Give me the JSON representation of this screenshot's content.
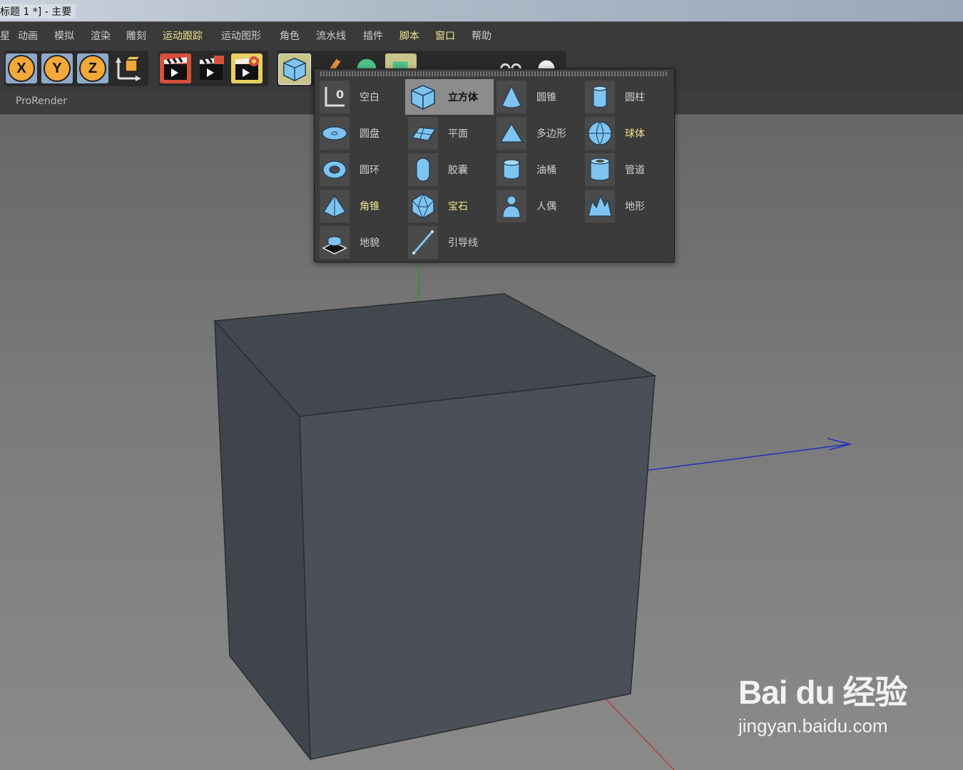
{
  "window": {
    "title": "标题 1 *] - 主要"
  },
  "menu": {
    "items": [
      {
        "label": "星",
        "hl": false
      },
      {
        "label": "动画",
        "hl": false
      },
      {
        "label": "模拟",
        "hl": false
      },
      {
        "label": "渲染",
        "hl": false
      },
      {
        "label": "雕刻",
        "hl": false
      },
      {
        "label": "运动跟踪",
        "hl": true
      },
      {
        "label": "运动图形",
        "hl": false
      },
      {
        "label": "角色",
        "hl": false
      },
      {
        "label": "流水线",
        "hl": false
      },
      {
        "label": "插件",
        "hl": false
      },
      {
        "label": "脚本",
        "hl": true
      },
      {
        "label": "窗口",
        "hl": true
      },
      {
        "label": "帮助",
        "hl": false
      }
    ]
  },
  "toolbar": {
    "axis_x": "X",
    "axis_y": "Y",
    "axis_z": "Z"
  },
  "viewport": {
    "renderer": "ProRender"
  },
  "primitives": {
    "items": [
      {
        "label": "空白",
        "icon": "null-icon",
        "highlighted": false,
        "active": false
      },
      {
        "label": "立方体",
        "icon": "cube-icon",
        "highlighted": false,
        "active": true
      },
      {
        "label": "圆锥",
        "icon": "cone-icon",
        "highlighted": false,
        "active": false
      },
      {
        "label": "圆柱",
        "icon": "cylinder-icon",
        "highlighted": false,
        "active": false
      },
      {
        "label": "圆盘",
        "icon": "disc-icon",
        "highlighted": false,
        "active": false
      },
      {
        "label": "平面",
        "icon": "plane-icon",
        "highlighted": false,
        "active": false
      },
      {
        "label": "多边形",
        "icon": "polygon-icon",
        "highlighted": false,
        "active": false
      },
      {
        "label": "球体",
        "icon": "sphere-icon",
        "highlighted": true,
        "active": false
      },
      {
        "label": "圆环",
        "icon": "torus-icon",
        "highlighted": false,
        "active": false
      },
      {
        "label": "胶囊",
        "icon": "capsule-icon",
        "highlighted": false,
        "active": false
      },
      {
        "label": "油桶",
        "icon": "oil-tank-icon",
        "highlighted": false,
        "active": false
      },
      {
        "label": "管道",
        "icon": "tube-icon",
        "highlighted": false,
        "active": false
      },
      {
        "label": "角锥",
        "icon": "pyramid-icon",
        "highlighted": true,
        "active": false
      },
      {
        "label": "宝石",
        "icon": "platonic-icon",
        "highlighted": true,
        "active": false
      },
      {
        "label": "人偶",
        "icon": "figure-icon",
        "highlighted": false,
        "active": false
      },
      {
        "label": "地形",
        "icon": "landscape-icon",
        "highlighted": false,
        "active": false
      },
      {
        "label": "地貌",
        "icon": "relief-icon",
        "highlighted": false,
        "active": false
      },
      {
        "label": "引导线",
        "icon": "guide-icon",
        "highlighted": false,
        "active": false
      }
    ]
  },
  "watermark": {
    "brand": "Bai du 经验",
    "url": "jingyan.baidu.com"
  },
  "colors": {
    "accent_text": "#f0e28c",
    "axis_x": "#c02020",
    "axis_y": "#20a020",
    "axis_z": "#2030c0",
    "icon_blue": "#7fc4f0"
  }
}
